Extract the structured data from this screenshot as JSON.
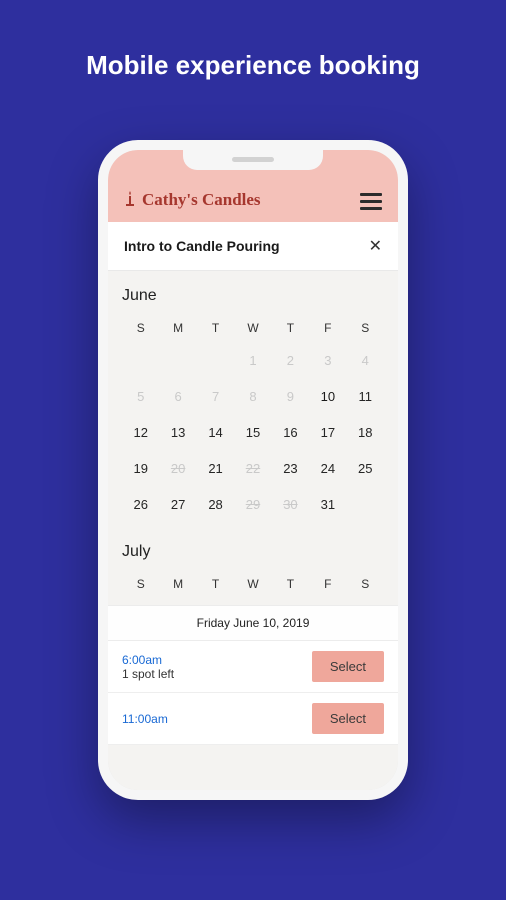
{
  "page_heading": "Mobile experience booking",
  "brand_name": "Cathy's Candles",
  "course_title": "Intro to Candle Pouring",
  "dow": [
    "S",
    "M",
    "T",
    "W",
    "T",
    "F",
    "S"
  ],
  "months": {
    "june": "June",
    "july": "July"
  },
  "june_weeks": [
    [
      {
        "label": "",
        "cls": ""
      },
      {
        "label": "",
        "cls": ""
      },
      {
        "label": "",
        "cls": ""
      },
      {
        "label": "1",
        "cls": "muted"
      },
      {
        "label": "2",
        "cls": "muted"
      },
      {
        "label": "3",
        "cls": "muted"
      },
      {
        "label": "4",
        "cls": "muted"
      }
    ],
    [
      {
        "label": "5",
        "cls": "muted"
      },
      {
        "label": "6",
        "cls": "muted"
      },
      {
        "label": "7",
        "cls": "muted"
      },
      {
        "label": "8",
        "cls": "muted"
      },
      {
        "label": "9",
        "cls": "muted"
      },
      {
        "label": "10",
        "cls": "selected"
      },
      {
        "label": "11",
        "cls": ""
      }
    ],
    [
      {
        "label": "12",
        "cls": ""
      },
      {
        "label": "13",
        "cls": ""
      },
      {
        "label": "14",
        "cls": ""
      },
      {
        "label": "15",
        "cls": ""
      },
      {
        "label": "16",
        "cls": ""
      },
      {
        "label": "17",
        "cls": ""
      },
      {
        "label": "18",
        "cls": ""
      }
    ],
    [
      {
        "label": "19",
        "cls": ""
      },
      {
        "label": "20",
        "cls": "strike"
      },
      {
        "label": "21",
        "cls": ""
      },
      {
        "label": "22",
        "cls": "strike"
      },
      {
        "label": "23",
        "cls": ""
      },
      {
        "label": "24",
        "cls": ""
      },
      {
        "label": "25",
        "cls": ""
      }
    ],
    [
      {
        "label": "26",
        "cls": ""
      },
      {
        "label": "27",
        "cls": ""
      },
      {
        "label": "28",
        "cls": ""
      },
      {
        "label": "29",
        "cls": "strike"
      },
      {
        "label": "30",
        "cls": "strike"
      },
      {
        "label": "31",
        "cls": ""
      },
      {
        "label": "",
        "cls": ""
      }
    ]
  ],
  "selected_date_label": "Friday June 10, 2019",
  "slots": [
    {
      "time": "6:00am",
      "avail": "1 spot left",
      "button": "Select"
    },
    {
      "time": "11:00am",
      "avail": "",
      "button": "Select"
    }
  ]
}
